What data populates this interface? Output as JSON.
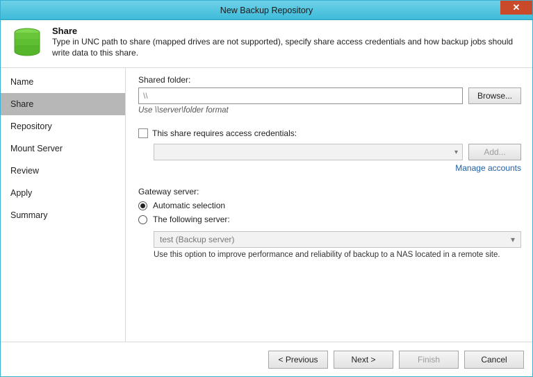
{
  "window": {
    "title": "New Backup Repository"
  },
  "header": {
    "title": "Share",
    "subtitle": "Type in UNC path to share (mapped drives are not supported), specify share access credentials and how backup jobs should write data to this share."
  },
  "sidebar": {
    "items": [
      {
        "label": "Name"
      },
      {
        "label": "Share"
      },
      {
        "label": "Repository"
      },
      {
        "label": "Mount Server"
      },
      {
        "label": "Review"
      },
      {
        "label": "Apply"
      },
      {
        "label": "Summary"
      }
    ],
    "selected_index": 1
  },
  "content": {
    "shared_folder_label": "Shared folder:",
    "shared_folder_value": "\\\\",
    "browse_label": "Browse...",
    "format_hint": "Use \\\\server\\folder format",
    "credentials_checkbox_label": "This share requires access credentials:",
    "credentials_selected": "",
    "add_label": "Add...",
    "manage_accounts_label": "Manage accounts",
    "gateway_label": "Gateway server:",
    "gateway_auto_label": "Automatic selection",
    "gateway_following_label": "The following server:",
    "gateway_selected_option": "auto",
    "server_combo_value": "test (Backup server)",
    "gateway_note": "Use this option to improve performance and reliability of backup to a NAS located in a remote site."
  },
  "footer": {
    "previous_label": "< Previous",
    "next_label": "Next >",
    "finish_label": "Finish",
    "cancel_label": "Cancel"
  }
}
